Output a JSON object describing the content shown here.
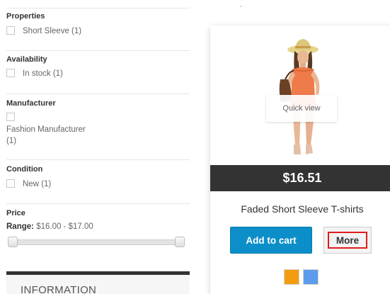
{
  "filters": {
    "properties": {
      "title": "Properties",
      "option": "Short Sleeve (1)"
    },
    "availability": {
      "title": "Availability",
      "option": "In stock (1)"
    },
    "manufacturer": {
      "title": "Manufacturer",
      "option_line1": "Fashion Manufacturer",
      "option_line2": "(1)"
    },
    "condition": {
      "title": "Condition",
      "option": "New (1)"
    },
    "price": {
      "title": "Price",
      "range_label": "Range:",
      "range_value": "$16.00 - $17.00"
    }
  },
  "information": {
    "title": "INFORMATION"
  },
  "product": {
    "quick_view_label": "Quick view",
    "price": "$16.51",
    "name": "Faded Short Sleeve T-shirts",
    "add_to_cart_label": "Add to cart",
    "more_label": "More",
    "color_swatches": [
      {
        "name": "Orange",
        "color": "#f39c11"
      },
      {
        "name": "Blue",
        "color": "#5d9cec"
      }
    ]
  },
  "colors": {
    "accent": "#0c8fc9",
    "highlight": "#e01b1b",
    "price_bar": "#333333"
  }
}
